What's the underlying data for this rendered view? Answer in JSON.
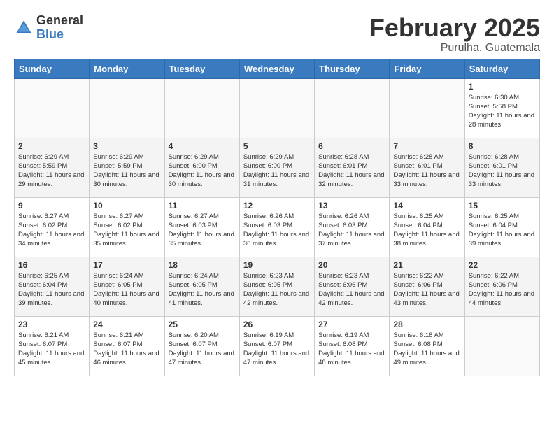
{
  "header": {
    "logo_general": "General",
    "logo_blue": "Blue",
    "month_title": "February 2025",
    "subtitle": "Purulha, Guatemala"
  },
  "weekdays": [
    "Sunday",
    "Monday",
    "Tuesday",
    "Wednesday",
    "Thursday",
    "Friday",
    "Saturday"
  ],
  "weeks": [
    [
      {
        "day": "",
        "info": ""
      },
      {
        "day": "",
        "info": ""
      },
      {
        "day": "",
        "info": ""
      },
      {
        "day": "",
        "info": ""
      },
      {
        "day": "",
        "info": ""
      },
      {
        "day": "",
        "info": ""
      },
      {
        "day": "1",
        "info": "Sunrise: 6:30 AM\nSunset: 5:58 PM\nDaylight: 11 hours and 28 minutes."
      }
    ],
    [
      {
        "day": "2",
        "info": "Sunrise: 6:29 AM\nSunset: 5:59 PM\nDaylight: 11 hours and 29 minutes."
      },
      {
        "day": "3",
        "info": "Sunrise: 6:29 AM\nSunset: 5:59 PM\nDaylight: 11 hours and 30 minutes."
      },
      {
        "day": "4",
        "info": "Sunrise: 6:29 AM\nSunset: 6:00 PM\nDaylight: 11 hours and 30 minutes."
      },
      {
        "day": "5",
        "info": "Sunrise: 6:29 AM\nSunset: 6:00 PM\nDaylight: 11 hours and 31 minutes."
      },
      {
        "day": "6",
        "info": "Sunrise: 6:28 AM\nSunset: 6:01 PM\nDaylight: 11 hours and 32 minutes."
      },
      {
        "day": "7",
        "info": "Sunrise: 6:28 AM\nSunset: 6:01 PM\nDaylight: 11 hours and 33 minutes."
      },
      {
        "day": "8",
        "info": "Sunrise: 6:28 AM\nSunset: 6:01 PM\nDaylight: 11 hours and 33 minutes."
      }
    ],
    [
      {
        "day": "9",
        "info": "Sunrise: 6:27 AM\nSunset: 6:02 PM\nDaylight: 11 hours and 34 minutes."
      },
      {
        "day": "10",
        "info": "Sunrise: 6:27 AM\nSunset: 6:02 PM\nDaylight: 11 hours and 35 minutes."
      },
      {
        "day": "11",
        "info": "Sunrise: 6:27 AM\nSunset: 6:03 PM\nDaylight: 11 hours and 35 minutes."
      },
      {
        "day": "12",
        "info": "Sunrise: 6:26 AM\nSunset: 6:03 PM\nDaylight: 11 hours and 36 minutes."
      },
      {
        "day": "13",
        "info": "Sunrise: 6:26 AM\nSunset: 6:03 PM\nDaylight: 11 hours and 37 minutes."
      },
      {
        "day": "14",
        "info": "Sunrise: 6:25 AM\nSunset: 6:04 PM\nDaylight: 11 hours and 38 minutes."
      },
      {
        "day": "15",
        "info": "Sunrise: 6:25 AM\nSunset: 6:04 PM\nDaylight: 11 hours and 39 minutes."
      }
    ],
    [
      {
        "day": "16",
        "info": "Sunrise: 6:25 AM\nSunset: 6:04 PM\nDaylight: 11 hours and 39 minutes."
      },
      {
        "day": "17",
        "info": "Sunrise: 6:24 AM\nSunset: 6:05 PM\nDaylight: 11 hours and 40 minutes."
      },
      {
        "day": "18",
        "info": "Sunrise: 6:24 AM\nSunset: 6:05 PM\nDaylight: 11 hours and 41 minutes."
      },
      {
        "day": "19",
        "info": "Sunrise: 6:23 AM\nSunset: 6:05 PM\nDaylight: 11 hours and 42 minutes."
      },
      {
        "day": "20",
        "info": "Sunrise: 6:23 AM\nSunset: 6:06 PM\nDaylight: 11 hours and 42 minutes."
      },
      {
        "day": "21",
        "info": "Sunrise: 6:22 AM\nSunset: 6:06 PM\nDaylight: 11 hours and 43 minutes."
      },
      {
        "day": "22",
        "info": "Sunrise: 6:22 AM\nSunset: 6:06 PM\nDaylight: 11 hours and 44 minutes."
      }
    ],
    [
      {
        "day": "23",
        "info": "Sunrise: 6:21 AM\nSunset: 6:07 PM\nDaylight: 11 hours and 45 minutes."
      },
      {
        "day": "24",
        "info": "Sunrise: 6:21 AM\nSunset: 6:07 PM\nDaylight: 11 hours and 46 minutes."
      },
      {
        "day": "25",
        "info": "Sunrise: 6:20 AM\nSunset: 6:07 PM\nDaylight: 11 hours and 47 minutes."
      },
      {
        "day": "26",
        "info": "Sunrise: 6:19 AM\nSunset: 6:07 PM\nDaylight: 11 hours and 47 minutes."
      },
      {
        "day": "27",
        "info": "Sunrise: 6:19 AM\nSunset: 6:08 PM\nDaylight: 11 hours and 48 minutes."
      },
      {
        "day": "28",
        "info": "Sunrise: 6:18 AM\nSunset: 6:08 PM\nDaylight: 11 hours and 49 minutes."
      },
      {
        "day": "",
        "info": ""
      }
    ]
  ]
}
